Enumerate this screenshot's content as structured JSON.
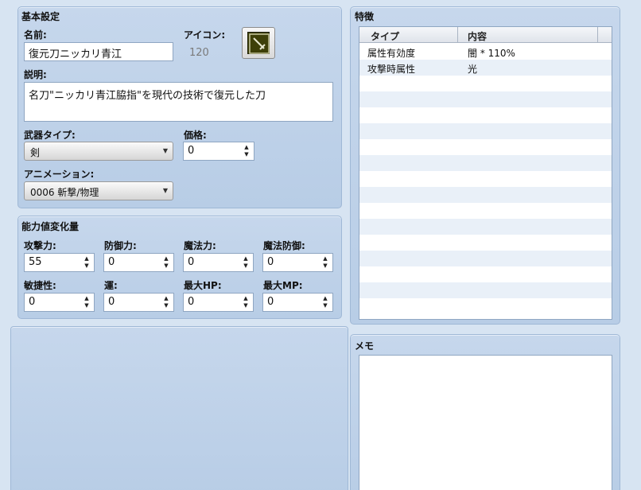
{
  "basic": {
    "title": "基本設定",
    "name_label": "名前:",
    "name_value": "復元刀ニッカリ青江",
    "icon_label": "アイコン:",
    "icon_index": "120",
    "icon_name": "sword-icon",
    "desc_label": "説明:",
    "desc_value": "名刀\"ニッカリ青江脇指\"を現代の技術で復元した刀",
    "weapon_type_label": "武器タイプ:",
    "weapon_type_value": "剣",
    "price_label": "価格:",
    "price_value": "0",
    "animation_label": "アニメーション:",
    "animation_value": "0006 斬撃/物理"
  },
  "params": {
    "title": "能力値変化量",
    "fields": [
      {
        "label": "攻撃力:",
        "value": "55"
      },
      {
        "label": "防御力:",
        "value": "0"
      },
      {
        "label": "魔法力:",
        "value": "0"
      },
      {
        "label": "魔法防御:",
        "value": "0"
      },
      {
        "label": "敏捷性:",
        "value": "0"
      },
      {
        "label": "運:",
        "value": "0"
      },
      {
        "label": "最大HP:",
        "value": "0"
      },
      {
        "label": "最大MP:",
        "value": "0"
      }
    ]
  },
  "traits": {
    "title": "特徴",
    "columns": [
      "タイプ",
      "内容"
    ],
    "rows": [
      {
        "type": "属性有効度",
        "content": "闇 * 110%"
      },
      {
        "type": "攻撃時属性",
        "content": "光"
      }
    ]
  },
  "memo": {
    "title": "メモ",
    "value": ""
  }
}
